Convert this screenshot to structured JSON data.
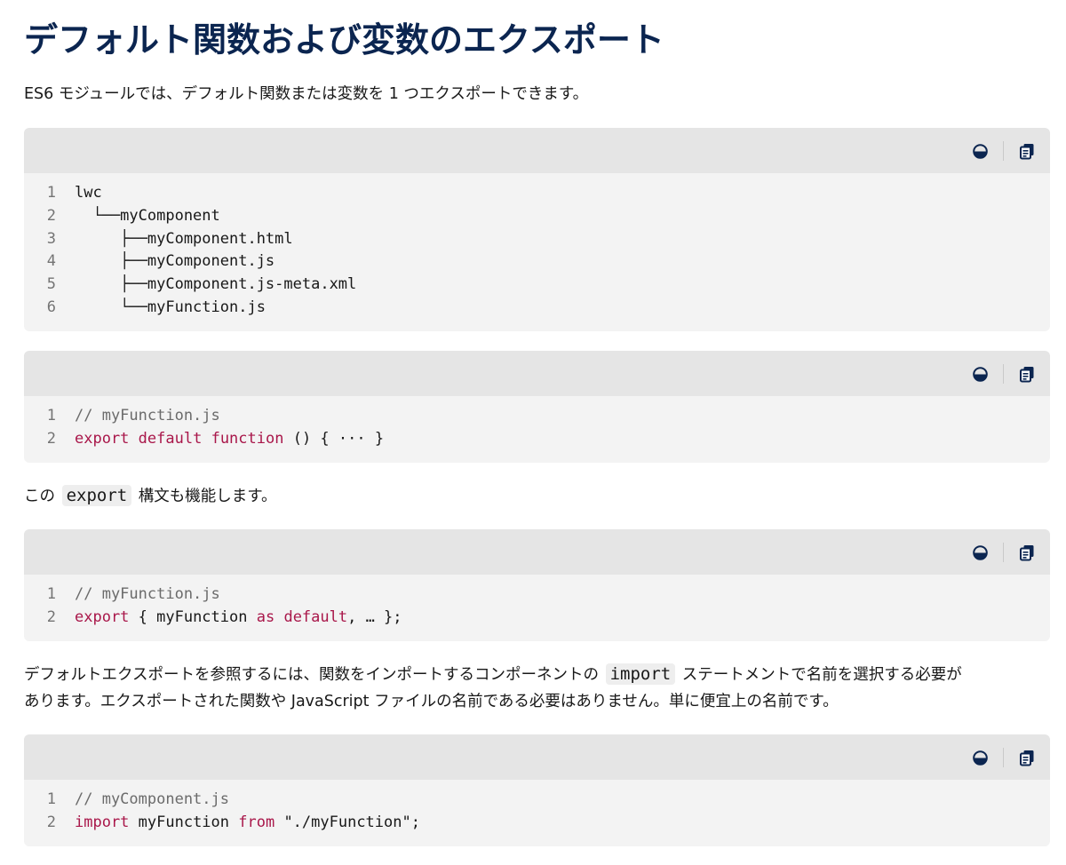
{
  "heading": "デフォルト関数および変数のエクスポート",
  "intro": "ES6 モジュールでは、デフォルト関数または変数を 1 つエクスポートできます。",
  "para2": {
    "before": "この",
    "code": "export",
    "after": "構文も機能します。"
  },
  "para3": {
    "before": "デフォルトエクスポートを参照するには、関数をインポートするコンポーネントの",
    "code": "import",
    "after": "ステートメントで名前を選択する必要が",
    "line2": "あります。エクスポートされた関数や JavaScript ファイルの名前である必要はありません。単に便宜上の名前です。"
  },
  "toolbar": {
    "theme_icon": "theme-toggle-icon",
    "copy_icon": "copy-icon",
    "icon_color": "#0b2550"
  },
  "code_blocks": [
    {
      "lines": [
        {
          "num": "1",
          "tokens": [
            {
              "t": "lwc",
              "c": "pl"
            }
          ]
        },
        {
          "num": "2",
          "tokens": [
            {
              "t": "  └──myComponent",
              "c": "pl"
            }
          ]
        },
        {
          "num": "3",
          "tokens": [
            {
              "t": "     ├──myComponent.html",
              "c": "pl"
            }
          ]
        },
        {
          "num": "4",
          "tokens": [
            {
              "t": "     ├──myComponent.js",
              "c": "pl"
            }
          ]
        },
        {
          "num": "5",
          "tokens": [
            {
              "t": "     ├──myComponent.js-meta.xml",
              "c": "pl"
            }
          ]
        },
        {
          "num": "6",
          "tokens": [
            {
              "t": "     └──myFunction.js",
              "c": "pl"
            }
          ]
        }
      ]
    },
    {
      "lines": [
        {
          "num": "1",
          "tokens": [
            {
              "t": "// myFunction.js",
              "c": "cm"
            }
          ]
        },
        {
          "num": "2",
          "tokens": [
            {
              "t": "export",
              "c": "kw"
            },
            {
              "t": " ",
              "c": "pl"
            },
            {
              "t": "default",
              "c": "kw"
            },
            {
              "t": " ",
              "c": "pl"
            },
            {
              "t": "function",
              "c": "kw"
            },
            {
              "t": " () { ··· }",
              "c": "pl"
            }
          ]
        }
      ]
    },
    {
      "lines": [
        {
          "num": "1",
          "tokens": [
            {
              "t": "// myFunction.js",
              "c": "cm"
            }
          ]
        },
        {
          "num": "2",
          "tokens": [
            {
              "t": "export",
              "c": "kw"
            },
            {
              "t": " { myFunction ",
              "c": "pl"
            },
            {
              "t": "as",
              "c": "kw"
            },
            {
              "t": " ",
              "c": "pl"
            },
            {
              "t": "default",
              "c": "kw"
            },
            {
              "t": ", … };",
              "c": "pl"
            }
          ]
        }
      ]
    },
    {
      "lines": [
        {
          "num": "1",
          "tokens": [
            {
              "t": "// myComponent.js",
              "c": "cm"
            }
          ]
        },
        {
          "num": "2",
          "tokens": [
            {
              "t": "import",
              "c": "kw"
            },
            {
              "t": " myFunction ",
              "c": "pl"
            },
            {
              "t": "from",
              "c": "kw"
            },
            {
              "t": " \"./myFunction\";",
              "c": "st"
            }
          ]
        }
      ]
    }
  ]
}
